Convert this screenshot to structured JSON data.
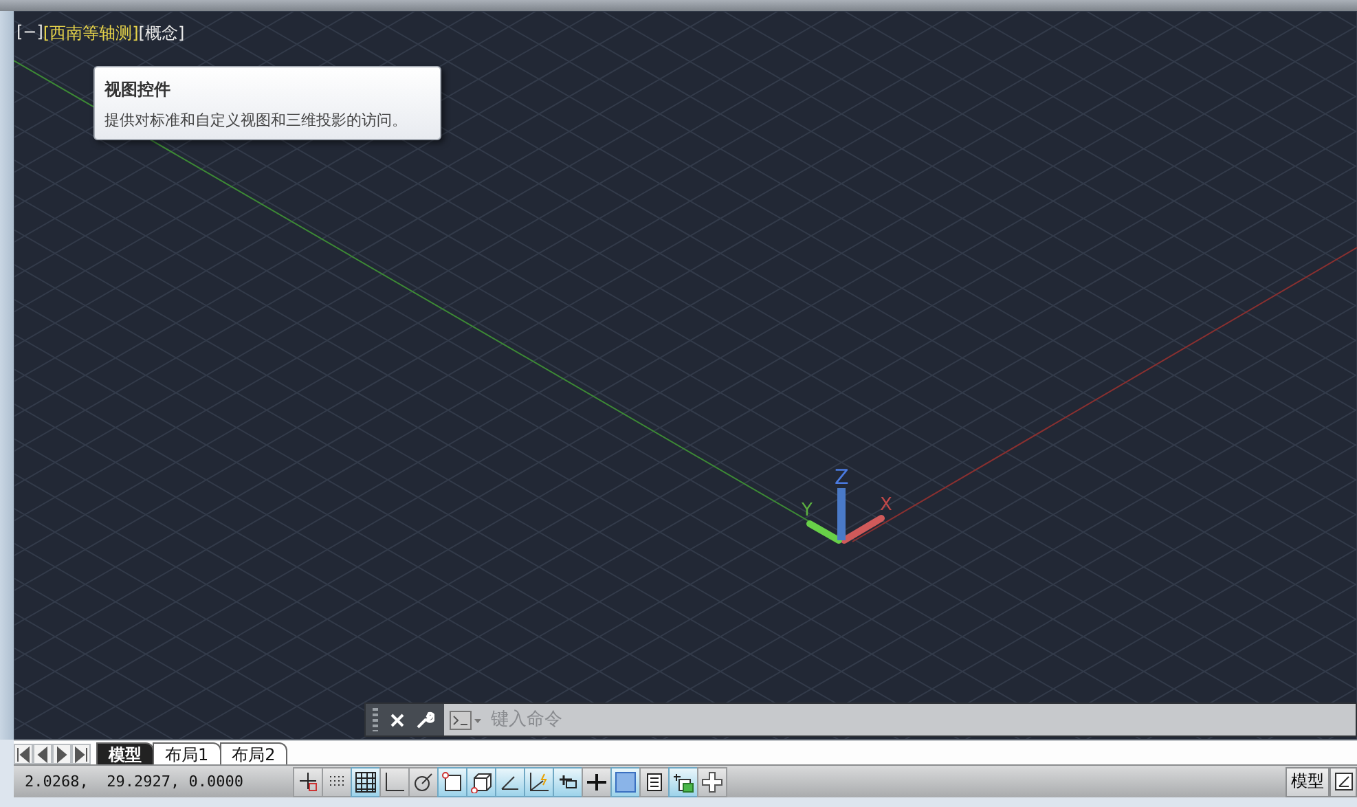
{
  "viewport_label": [
    {
      "text": "[−]",
      "hovered": false
    },
    {
      "text": "[西南等轴测]",
      "hovered": true
    },
    {
      "text": "[概念]",
      "hovered": false
    }
  ],
  "tooltip": {
    "title": "视图控件",
    "description": "提供对标准和自定义视图和三维投影的访问。"
  },
  "ucs": {
    "x_label": "X",
    "y_label": "Y",
    "z_label": "Z"
  },
  "command_line": {
    "placeholder": "键入命令"
  },
  "layout_tabs": [
    {
      "label": "模型",
      "selected": true
    },
    {
      "label": "布局1",
      "selected": false
    },
    {
      "label": "布局2",
      "selected": false
    }
  ],
  "status_bar": {
    "coordinates": "2.0268,  29.2927, 0.0000",
    "toggles": [
      {
        "kind": "snap",
        "on": false
      },
      {
        "kind": "dots",
        "on": false
      },
      {
        "kind": "grid",
        "on": true
      },
      {
        "kind": "ortho",
        "on": false
      },
      {
        "kind": "polar",
        "on": false
      },
      {
        "kind": "osnap",
        "on": true
      },
      {
        "kind": "box3d",
        "on": true
      },
      {
        "kind": "angle",
        "on": true
      },
      {
        "kind": "axes",
        "on": true
      },
      {
        "kind": "track",
        "on": true
      },
      {
        "kind": "cross",
        "on": false
      },
      {
        "kind": "hatch",
        "on": true
      },
      {
        "kind": "list",
        "on": false
      },
      {
        "kind": "layers",
        "on": true
      },
      {
        "kind": "plus",
        "on": false
      }
    ],
    "model_button": "模型"
  }
}
